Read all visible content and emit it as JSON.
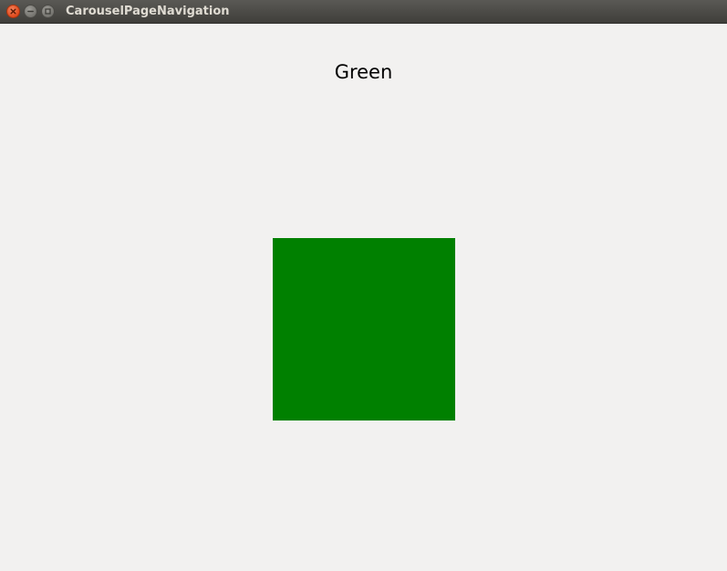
{
  "window": {
    "title": "CarouselPageNavigation"
  },
  "page": {
    "title": "Green",
    "box_color": "#008000"
  },
  "icons": {
    "close": "close-icon",
    "minimize": "minimize-icon",
    "maximize": "maximize-icon"
  }
}
